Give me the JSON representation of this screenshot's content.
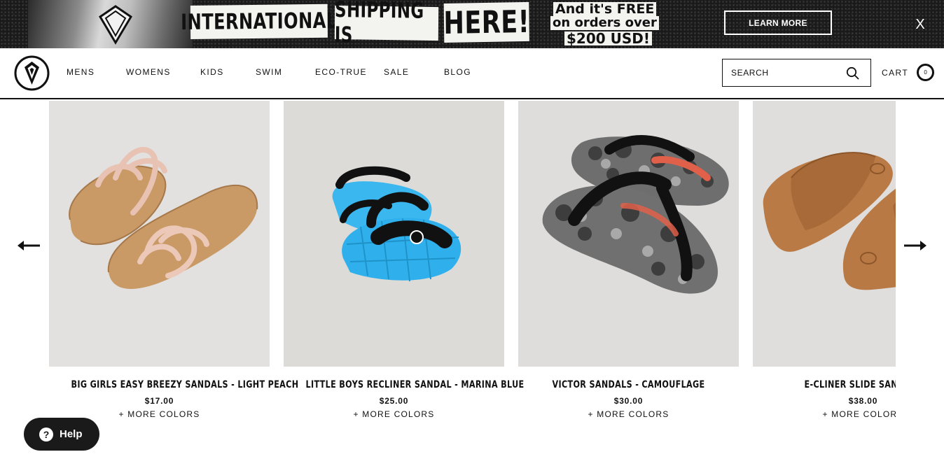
{
  "promo": {
    "headline_1": "INTERNATIONAL",
    "headline_2": "SHIPPING IS",
    "headline_3": "HERE!",
    "free_line_1": "And it's FREE",
    "free_line_2": "on orders over",
    "free_line_3": "$200 USD!",
    "cta_label": "LEARN MORE",
    "close_label": "X",
    "background_color": "#1a1a1a"
  },
  "header": {
    "logo_icon": "volcom-stone-logo",
    "nav": [
      {
        "label": "MENS"
      },
      {
        "label": "WOMENS"
      },
      {
        "label": "KIDS"
      },
      {
        "label": "SWIM"
      },
      {
        "label": "ECO-TRUE"
      },
      {
        "label": "SALE"
      },
      {
        "label": "BLOG"
      }
    ],
    "search": {
      "placeholder": "SEARCH",
      "value": "",
      "icon": "search-icon"
    },
    "cart": {
      "label": "CART",
      "count": "0"
    }
  },
  "carousel": {
    "prev_icon": "arrow-left-icon",
    "next_icon": "arrow-right-icon",
    "products": [
      {
        "name": "BIG GIRLS EASY BREEZY SANDALS - LIGHT PEACH",
        "price": "$17.00",
        "more": "+ MORE COLORS",
        "image": "peach strappy sandals",
        "image_bg": "#e2e1df"
      },
      {
        "name": "LITTLE BOYS RECLINER SANDAL - MARINA BLUE",
        "price": "$25.00",
        "more": "+ MORE COLORS",
        "image": "blue kids sandals with back strap",
        "image_bg": "#dcdbd8"
      },
      {
        "name": "VICTOR SANDALS - CAMOUFLAGE",
        "price": "$30.00",
        "more": "+ MORE COLORS",
        "image": "camouflage flip flops",
        "image_bg": "#dedddb"
      },
      {
        "name": "E-CLINER SLIDE SANDALS",
        "price": "$38.00",
        "more": "+ MORE COLORS",
        "image": "brown slide sandals",
        "image_bg": "#dfdedc"
      }
    ]
  },
  "help": {
    "label": "Help",
    "icon": "question-icon"
  }
}
